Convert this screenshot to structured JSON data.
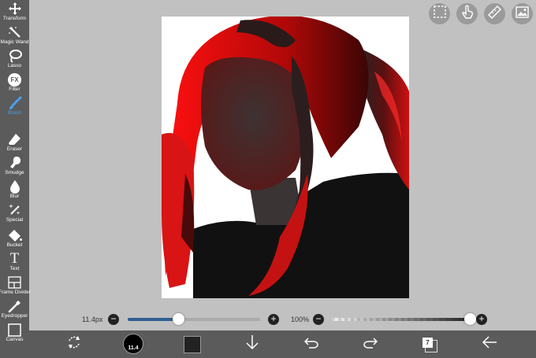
{
  "toolbar": {
    "items": [
      {
        "label": "Transform",
        "icon": "move-icon"
      },
      {
        "label": "Magic Wand",
        "icon": "magic-wand-icon"
      },
      {
        "label": "Lasso",
        "icon": "lasso-icon"
      },
      {
        "label": "Filter",
        "icon": "fx-icon"
      },
      {
        "label": "Brush",
        "icon": "brush-icon"
      },
      {
        "label": "Eraser",
        "icon": "eraser-icon"
      },
      {
        "label": "Smudge",
        "icon": "smudge-icon"
      },
      {
        "label": "Blur",
        "icon": "drop-icon"
      },
      {
        "label": "Special",
        "icon": "sparkle-icon"
      },
      {
        "label": "Bucket",
        "icon": "bucket-icon"
      },
      {
        "label": "Text",
        "icon": "text-icon"
      },
      {
        "label": "Frame Divider",
        "icon": "frame-divider-icon"
      },
      {
        "label": "Eyedropper",
        "icon": "eyedropper-icon"
      },
      {
        "label": "Canvas",
        "icon": "canvas-icon"
      }
    ],
    "active": "Brush",
    "active_color": "#4a9fe8",
    "filter_glyph": "FX",
    "text_glyph": "T"
  },
  "brush_size": {
    "value_label": "11.4px",
    "level": 0.38
  },
  "opacity": {
    "value_label": "100%",
    "level": 1.0
  },
  "bottom_bar": {
    "brush_preview_label": "11.4",
    "current_color": "#222222",
    "layer_count": "7"
  },
  "colors": {
    "toolbar_bg": "#5b5b5b",
    "workspace_bg": "#c1c1c1",
    "slider_fill": "#2f5f93"
  }
}
